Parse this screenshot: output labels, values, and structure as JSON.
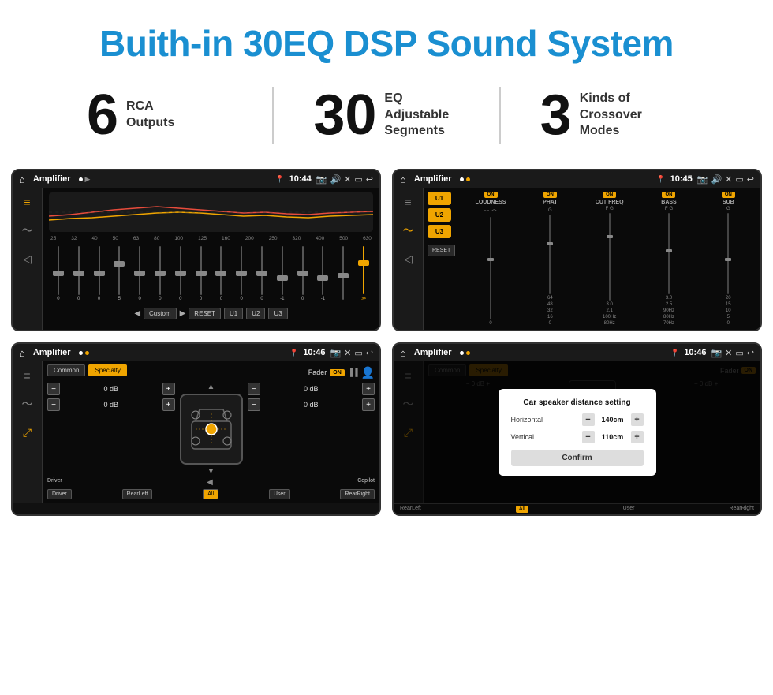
{
  "page": {
    "title": "Buith-in 30EQ DSP Sound System",
    "title_color": "#1a8fd1"
  },
  "stats": [
    {
      "number": "6",
      "label": "RCA\nOutputs"
    },
    {
      "number": "30",
      "label": "EQ Adjustable\nSegments"
    },
    {
      "number": "3",
      "label": "Kinds of\nCrossover Modes"
    }
  ],
  "screens": [
    {
      "id": "screen1",
      "status": {
        "app": "Amplifier",
        "time": "10:44"
      },
      "type": "eq",
      "eq_freqs": [
        "25",
        "32",
        "40",
        "50",
        "63",
        "80",
        "100",
        "125",
        "160",
        "200",
        "250",
        "320",
        "400",
        "500",
        "630"
      ],
      "eq_vals": [
        "0",
        "0",
        "0",
        "5",
        "0",
        "0",
        "0",
        "0",
        "0",
        "0",
        "0",
        "-1",
        "0",
        "-1",
        ""
      ],
      "preset": "Custom",
      "buttons": [
        "RESET",
        "U1",
        "U2",
        "U3"
      ]
    },
    {
      "id": "screen2",
      "status": {
        "app": "Amplifier",
        "time": "10:45"
      },
      "type": "dsp",
      "presets": [
        "U1",
        "U2",
        "U3"
      ],
      "channels": [
        {
          "name": "LOUDNESS",
          "on": true
        },
        {
          "name": "PHAT",
          "on": true
        },
        {
          "name": "CUT FREQ",
          "on": true
        },
        {
          "name": "BASS",
          "on": true
        },
        {
          "name": "SUB",
          "on": true
        }
      ]
    },
    {
      "id": "screen3",
      "status": {
        "app": "Amplifier",
        "time": "10:46"
      },
      "type": "fader",
      "tabs": [
        "Common",
        "Specialty"
      ],
      "active_tab": "Specialty",
      "fader_on": true,
      "fader_label": "Fader",
      "volume_rows": [
        {
          "val": "0 dB"
        },
        {
          "val": "0 dB"
        },
        {
          "val": "0 dB"
        },
        {
          "val": "0 dB"
        }
      ],
      "bottom_buttons": [
        "Driver",
        "RearLeft",
        "All",
        "User",
        "RearRight",
        "Copilot"
      ]
    },
    {
      "id": "screen4",
      "status": {
        "app": "Amplifier",
        "time": "10:46"
      },
      "type": "fader_dialog",
      "dialog": {
        "title": "Car speaker distance setting",
        "rows": [
          {
            "label": "Horizontal",
            "value": "140cm"
          },
          {
            "label": "Vertical",
            "value": "110cm"
          }
        ],
        "confirm": "Confirm"
      }
    }
  ]
}
